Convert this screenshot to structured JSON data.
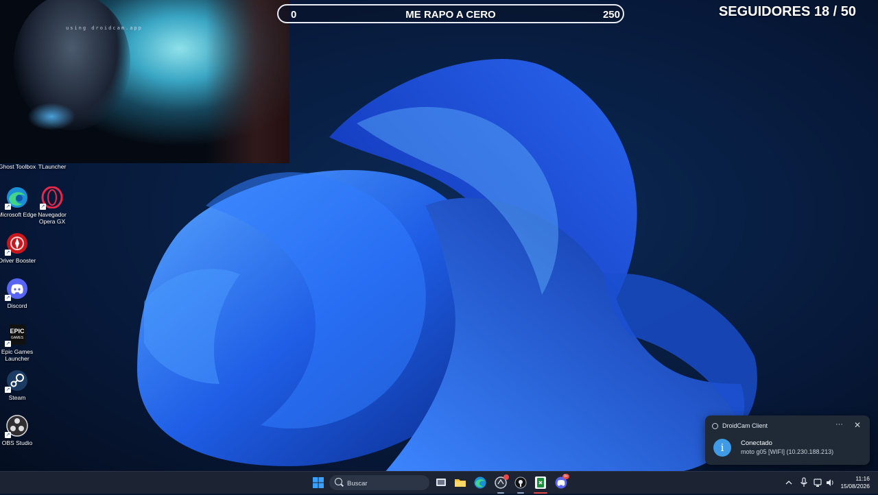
{
  "webcam": {
    "watermark": "using droidcam.app"
  },
  "goal_bar": {
    "min": "0",
    "max": "250",
    "title": "ME RAPO A CERO",
    "progress": 0
  },
  "followers": {
    "label": "SEGUIDORES 18 / 50"
  },
  "desktop_icons": [
    {
      "label": "Ghost Toolbox",
      "icon": "ghost-toolbox-icon"
    },
    {
      "label": "TLauncher",
      "icon": "tlauncher-icon"
    },
    {
      "label": "Microsoft Edge",
      "icon": "edge-icon"
    },
    {
      "label": "Navegador Opera GX",
      "icon": "opera-gx-icon"
    },
    {
      "label": "Driver Booster",
      "icon": "driver-booster-icon"
    },
    {
      "label": "Discord",
      "icon": "discord-icon"
    },
    {
      "label": "Epic Games Launcher",
      "icon": "epic-games-icon",
      "logo_text": "EPIC GAMES"
    },
    {
      "label": "Steam",
      "icon": "steam-icon"
    },
    {
      "label": "OBS Studio",
      "icon": "obs-icon"
    }
  ],
  "notification": {
    "app_name": "DroidCam Client",
    "more": "···",
    "close": "✕",
    "title": "Conectado",
    "body": "moto g05 [WIFI] (10.230.188.213)"
  },
  "taskbar": {
    "search_placeholder": "Buscar",
    "time": "11:16",
    "date": "15/08/2026",
    "discord_badge": "9+"
  },
  "colors": {
    "accent": "#2d6bd6",
    "taskbar": "#1c2433",
    "toast": "#1f2a36",
    "info": "#3f9be6"
  }
}
